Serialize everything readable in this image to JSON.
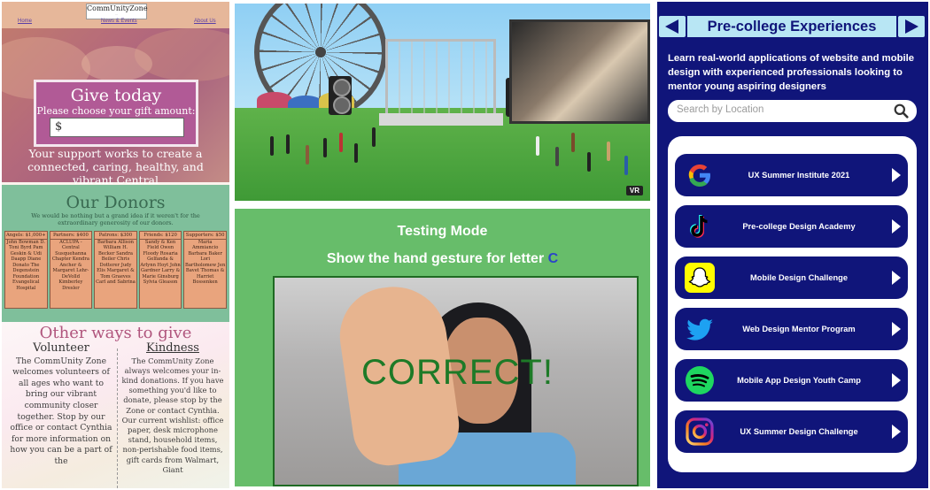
{
  "community": {
    "logo": "CommUnityZone",
    "logo_tagline": "...",
    "nav": {
      "home": "Home",
      "news": "News & Events",
      "about": "About Us"
    },
    "give": {
      "title": "Give today",
      "subtitle": "Please choose your gift amount:",
      "amount_value": "$",
      "support_text": "Your support works to create a connected, caring, healthy, and vibrant Central"
    },
    "donors": {
      "title": "Our Donors",
      "intro": "We would be nothing but a grand idea if it weren't for the extraordinary generosity of our donors.",
      "tiers": [
        {
          "name": "Angels: $1,000+",
          "names": "John Bowman D. Toni Byrd Pam Geskin & Udi Daapp Diane Donato The Degenstein Foundation Evangelical Hospital"
        },
        {
          "name": "Partners: $400",
          "names": "ACLUPA - Central Susquehanna Chapter Kendra Ancher & Margaret Lehr-DeVolld Kimberley Dresler"
        },
        {
          "name": "Patrons: $300",
          "names": "Barbara Allison William H. Becker Sandra Beiler Chris Dotterer Judy Elis Margaret & Tom Graeves Carl and Sabrina"
        },
        {
          "name": "Friends: $120",
          "names": "Sandy & Ken Field Owen Floody Rosaria Gelfanda & Arlynn Hoyt John Gardner Larry & Marie Ginsburg Sylvia Gleason"
        },
        {
          "name": "Supporters: $50",
          "names": "Maria Ammiancio Barbara Baker Lori Bartholomew Jen Bavet Thomas & Harriet Bossenken"
        }
      ]
    },
    "other_ways": {
      "title": "Other ways to give",
      "volunteer": {
        "heading": "Volunteer",
        "text": "The CommUnity Zone welcomes volunteers of all ages who want to bring our vibrant community closer together. Stop by our office or contact Cynthia for more information on how you can be a part of the"
      },
      "kindness": {
        "heading": "Kindness",
        "text": "The CommUnity Zone always welcomes your in-kind donations. If you have something you'd like to donate, please stop by the Zone or contact Cynthia. Our current wishlist: office paper, desk microphone stand, household items, non-perishable food items, gift cards from Walmart, Giant"
      }
    }
  },
  "vr_scene": {
    "badge": "VR"
  },
  "testing": {
    "title": "Testing Mode",
    "prompt_prefix": "Show the hand gesture for letter",
    "letter": "C",
    "result": "CORRECT!"
  },
  "precollege": {
    "title": "Pre-college Experiences",
    "description": "Learn real-world applications of website and mobile design with experienced professionals looking to mentor young aspiring designers",
    "search_placeholder": "Search by Location",
    "items": [
      {
        "label": "UX Summer Institute 2021",
        "icon": "google-icon"
      },
      {
        "label": "Pre-college Design Academy",
        "icon": "tiktok-icon"
      },
      {
        "label": "Mobile Design Challenge",
        "icon": "snapchat-icon"
      },
      {
        "label": "Web Design Mentor Program",
        "icon": "twitter-icon"
      },
      {
        "label": "Mobile App Design Youth Camp",
        "icon": "spotify-icon"
      },
      {
        "label": "UX Summer Design Challenge",
        "icon": "instagram-icon"
      }
    ],
    "colors": {
      "navy": "#10157a",
      "light_blue": "#b8e6f4"
    }
  }
}
